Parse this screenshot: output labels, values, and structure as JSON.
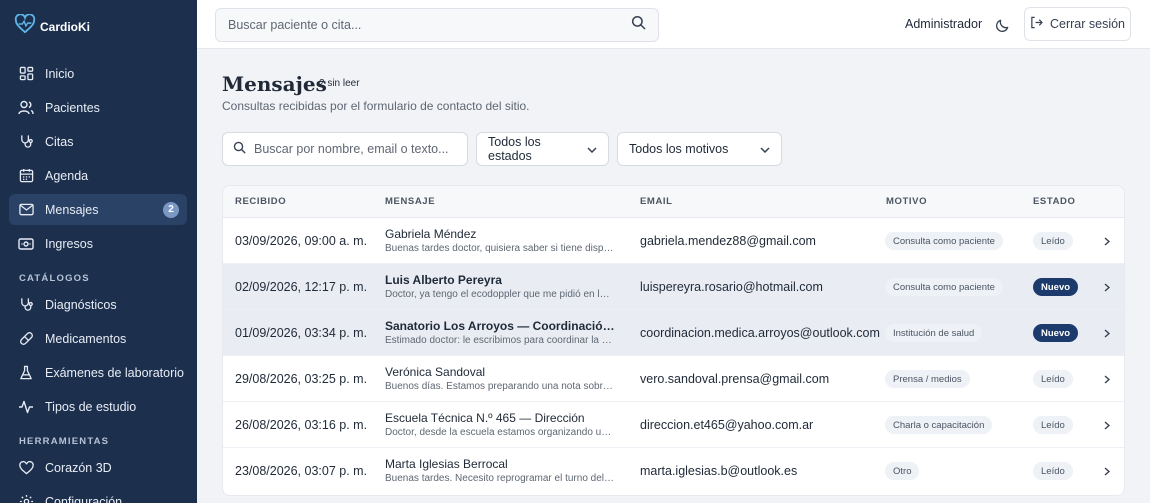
{
  "brand": {
    "name": "CardioKi"
  },
  "sidebar": {
    "items": [
      {
        "label": "Inicio",
        "icon": "dashboard-icon"
      },
      {
        "label": "Pacientes",
        "icon": "users-icon"
      },
      {
        "label": "Citas",
        "icon": "stethoscope-icon"
      },
      {
        "label": "Agenda",
        "icon": "calendar-icon"
      },
      {
        "label": "Mensajes",
        "icon": "message-icon",
        "badge": "2",
        "active": true
      },
      {
        "label": "Ingresos",
        "icon": "cash-icon"
      }
    ],
    "section_catalogs": "CATÁLOGOS",
    "catalog_items": [
      {
        "label": "Diagnósticos",
        "icon": "activity-icon"
      },
      {
        "label": "Medicamentos",
        "icon": "pill-icon"
      },
      {
        "label": "Exámenes de laboratorio",
        "icon": "flask-icon"
      },
      {
        "label": "Tipos de estudio",
        "icon": "pulse-icon"
      }
    ],
    "section_tools": "HERRAMIENTAS",
    "tool_items": [
      {
        "label": "Corazón 3D",
        "icon": "heart-icon"
      },
      {
        "label": "Configuración",
        "icon": "gear-icon"
      }
    ]
  },
  "topbar": {
    "search_placeholder": "Buscar paciente o cita...",
    "user": "Administrador",
    "logout": "Cerrar sesión"
  },
  "page": {
    "title": "Mensajes",
    "unread": "2 sin leer",
    "subtitle": "Consultas recibidas por el formulario de contacto del sitio."
  },
  "filters": {
    "search_placeholder": "Buscar por nombre, email o texto...",
    "status": "Todos los estados",
    "reason": "Todos los motivos"
  },
  "table": {
    "headers": {
      "received": "RECIBIDO",
      "message": "MENSAJE",
      "email": "EMAIL",
      "reason": "MOTIVO",
      "status": "ESTADO"
    },
    "rows": [
      {
        "date": "03/09/2026, 09:00 a. m.",
        "name": "Gabriela Méndez",
        "snippet": "Buenas tardes doctor, quisiera saber si tiene disponibilidad",
        "email": "gabriela.mendez88@gmail.com",
        "reason": "Consulta como paciente",
        "status": "Leído",
        "unread": false
      },
      {
        "date": "02/09/2026, 12:17 p. m.",
        "name": "Luis Alberto Pereyra",
        "snippet": "Doctor, ya tengo el ecodoppler que me pidió en la última consulta",
        "email": "luispereyra.rosario@hotmail.com",
        "reason": "Consulta como paciente",
        "status": "Nuevo",
        "unread": true
      },
      {
        "date": "01/09/2026, 03:34 p. m.",
        "name": "Sanatorio Los Arroyos — Coordinación médica",
        "snippet": "Estimado doctor: le escribimos para coordinar la derivación",
        "email": "coordinacion.medica.arroyos@outlook.com",
        "reason": "Institución de salud",
        "status": "Nuevo",
        "unread": true
      },
      {
        "date": "29/08/2026, 03:25 p. m.",
        "name": "Verónica Sandoval",
        "snippet": "Buenos días. Estamos preparando una nota sobre salud cardiovascular",
        "email": "vero.sandoval.prensa@gmail.com",
        "reason": "Prensa / medios",
        "status": "Leído",
        "unread": false
      },
      {
        "date": "26/08/2026, 03:16 p. m.",
        "name": "Escuela Técnica N.º 465 — Dirección",
        "snippet": "Doctor, desde la escuela estamos organizando una charla",
        "email": "direccion.et465@yahoo.com.ar",
        "reason": "Charla o capacitación",
        "status": "Leído",
        "unread": false
      },
      {
        "date": "23/08/2026, 03:07 p. m.",
        "name": "Marta Iglesias Berrocal",
        "snippet": "Buenas tardes. Necesito reprogramar el turno del jueves",
        "email": "marta.iglesias.b@outlook.es",
        "reason": "Otro",
        "status": "Leído",
        "unread": false
      }
    ]
  },
  "colors": {
    "sidebar": "#1c2f4d",
    "active": "#2a4266",
    "badge": "#7b97c4",
    "status_new": "#1c3a6b"
  }
}
